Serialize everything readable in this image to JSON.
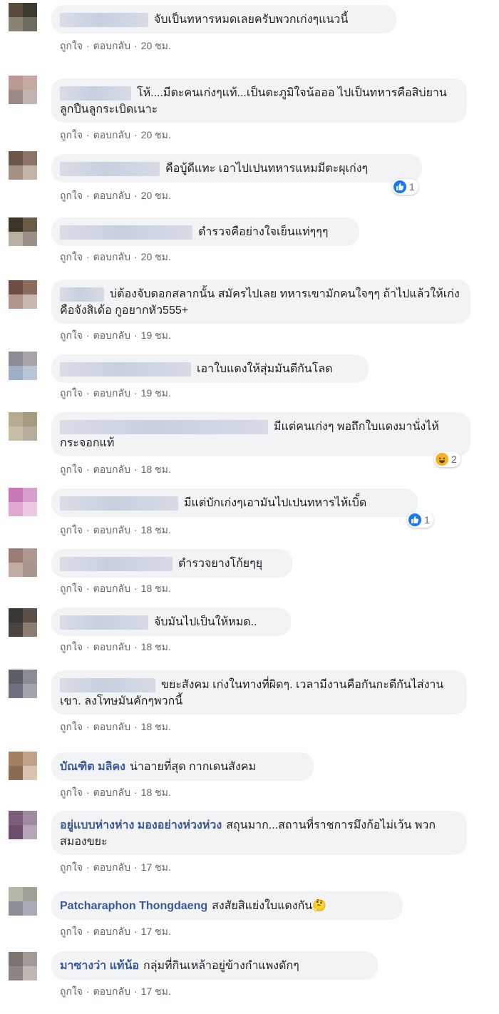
{
  "actions": {
    "like": "ถูกใจ",
    "reply": "ตอบกลับ",
    "dot": "·"
  },
  "colors": {
    "bubble_bg": "#f2f3f5",
    "author": "#385898",
    "action_text": "#606770",
    "like_blue": "#1877f2"
  },
  "comments": [
    {
      "author": "",
      "text": "จับเป็นทหารหมดเลยครับพวกเก่งๆแนวนี้",
      "time": "20 ชม.",
      "reaction": null
    },
    {
      "author": "",
      "text": "โห้....มีตะคนเก่งๆแท้...เป็นตะภูมิใจน้อออ ไปเป็นทหารคือสิบ่ยานลูกปืนลูกระเบิดเนาะ",
      "time": "20 ชม.",
      "reaction": null
    },
    {
      "author": "",
      "text": "คือบู้ดีแทะ เอาไปเปนทหารแหมมีตะผุเก่งๆ",
      "time": "20 ชม.",
      "reaction": {
        "icon": "like-icon",
        "count": "1"
      }
    },
    {
      "author": "",
      "text": "ตำรวจคือย่างใจเย็นแท่ๆๆๆ",
      "time": "20 ชม.",
      "reaction": null
    },
    {
      "author": "",
      "text": "บ่ต้องจับดอกสลากนั้น สมัครไปเลย ทหารเขามักคนใจๆๆ ถ้าไปแล้วให้เก่งคือจังสิเด้อ กูอยากหัว555+",
      "time": "19 ชม.",
      "reaction": null
    },
    {
      "author": "",
      "text": "เอาใบแดงให้สุ่มมันตีกันโลด",
      "time": "19 ชม.",
      "reaction": null
    },
    {
      "author": "",
      "text": "มีแต่คนเก่งๆ พอถึกใบแดงมานั่งไห้ กระจอกแท้",
      "time": "18 ชม.",
      "reaction": {
        "icon": "haha-icon",
        "count": "2"
      }
    },
    {
      "author": "",
      "text": "มีแต่บักเก่งๆเอามันไปเปนทหารไห้เบิ็ด",
      "time": "18 ชม.",
      "reaction": {
        "icon": "like-icon",
        "count": "1"
      }
    },
    {
      "author": "",
      "text": "ตำรวจยางโก้ยๆยุ",
      "time": "18 ชม.",
      "reaction": null
    },
    {
      "author": "",
      "text": "จับมันไปเป็นให้หมด..",
      "time": "18 ชม.",
      "reaction": null
    },
    {
      "author": "",
      "text": "ขยะสังคม เก่งในทางที่ผิดๆ. เวลามีงานคือกันกะตีกันไส่งานเขา. ลงโทษมันคักๆพวกนี้",
      "time": "18 ชม.",
      "reaction": null
    },
    {
      "author": "บัณฑิต มลิคง",
      "text": "น่าอายที่สุด กากเดนสังคม",
      "time": "18 ชม.",
      "reaction": null
    },
    {
      "author": "อยู่แบบห่างห่าง มองอย่างห่วงห่วง",
      "text": "สถุนมาก...สถานที่ราชการมึงก้อไม่เว้น พวกสมองขยะ",
      "time": "17 ชม.",
      "reaction": null
    },
    {
      "author": "Patcharaphon Thongdaeng",
      "text": "สงสัยสิแย่งใบแดงกัน🤔",
      "time": "17 ชม.",
      "reaction": null
    },
    {
      "author": "มาซางว่า แท้น้อ",
      "text": "กลุ่มที่กินเหล้าอยู่ข้างกำแพงดักๆ",
      "time": "17 ชม.",
      "reaction": null
    }
  ]
}
